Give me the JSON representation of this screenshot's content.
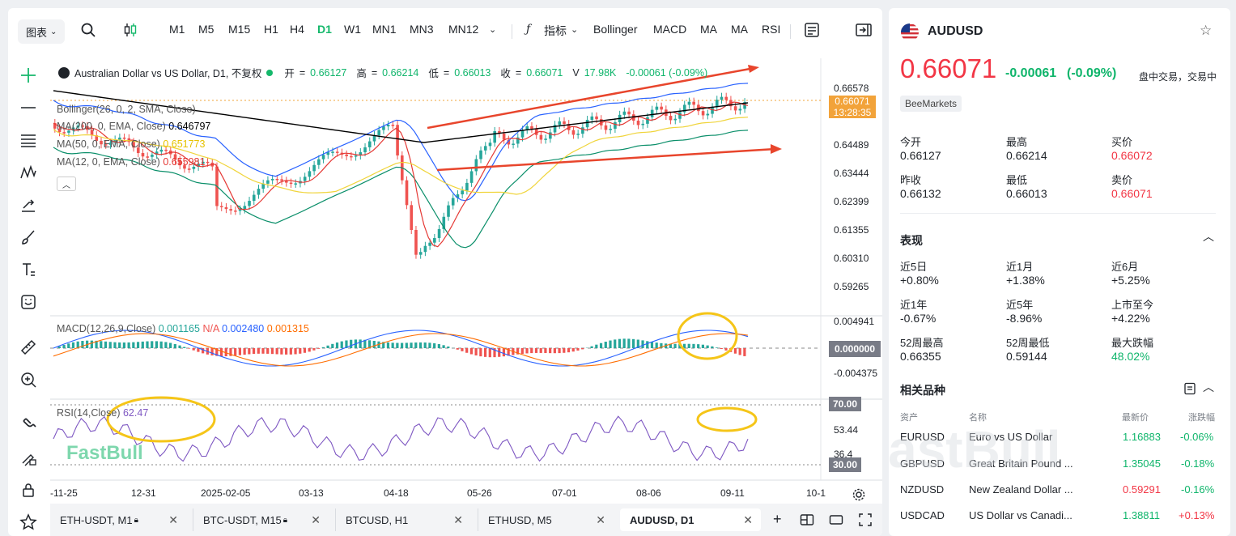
{
  "toolbar": {
    "chart_menu": "图表",
    "timeframes": [
      "M1",
      "M5",
      "M15",
      "H1",
      "H4",
      "D1",
      "W1",
      "MN1",
      "MN3",
      "MN12"
    ],
    "active_timeframe": "D1",
    "indicators_label": "指标",
    "indicator_buttons": [
      "Bollinger",
      "MACD",
      "MA",
      "MA",
      "RSI"
    ]
  },
  "chart": {
    "symbol_line": "Australian Dollar vs US Dollar, D1, 不复权",
    "ohlc": {
      "open_label": "开",
      "open": "0.66127",
      "high_label": "高",
      "high": "0.66214",
      "low_label": "低",
      "low": "0.66013",
      "close_label": "收",
      "close": "0.66071",
      "volume_label": "V",
      "volume": "17.98K",
      "change": "-0.00061 (-0.09%)"
    },
    "legends": {
      "bollinger": "Bollinger(26, 0, 2, SMA, Close)",
      "ma200": "MA(200, 0, EMA, Close)",
      "ma200_val": "0.646797",
      "ma50": "MA(50, 0, EMA, Close)",
      "ma50_val": "0.651773",
      "ma12": "MA(12, 0, EMA, Close)",
      "ma12_val": "0.655981"
    },
    "price_axis": [
      "0.66578",
      "0.64489",
      "0.63444",
      "0.62399",
      "0.61355",
      "0.60310",
      "0.59265"
    ],
    "current_price": "0.66071",
    "countdown": "13:28:35",
    "macd": {
      "label": "MACD(12,26,9,Close)",
      "hist": "0.001165",
      "na": "N/A",
      "macd": "0.002480",
      "signal": "0.001315",
      "axis": [
        "0.004941",
        "0.000000",
        "-0.004375"
      ]
    },
    "rsi": {
      "label": "RSI(14,Close)",
      "value": "62.47",
      "axis": [
        "70.00",
        "53.44",
        "36.4",
        "30.00"
      ]
    },
    "x_axis": [
      "-11-25",
      "12-31",
      "2025-02-05",
      "03-13",
      "04-18",
      "05-26",
      "07-01",
      "08-06",
      "09-11",
      "10-1"
    ],
    "watermark": "FastBull",
    "colors": {
      "up": "#26a69a",
      "down": "#ef5350",
      "accent": "#15b86b",
      "annotation": "#e8452c",
      "highlight": "#f5c518"
    }
  },
  "tabs": [
    {
      "label": "ETH-USDT, M1",
      "locked": true
    },
    {
      "label": "BTC-USDT, M15",
      "locked": true
    },
    {
      "label": "BTCUSD, H1",
      "locked": false
    },
    {
      "label": "ETHUSD, M5",
      "locked": false
    },
    {
      "label": "AUDUSD, D1",
      "locked": false,
      "active": true
    }
  ],
  "panel": {
    "symbol": "AUDUSD",
    "price": "0.66071",
    "change": "-0.00061",
    "change_pct": "(-0.09%)",
    "status": "盘中交易，交易中",
    "source": "BeeMarkets",
    "stats": [
      {
        "label": "今开",
        "value": "0.66127",
        "tone": ""
      },
      {
        "label": "最高",
        "value": "0.66214",
        "tone": ""
      },
      {
        "label": "买价",
        "value": "0.66072",
        "tone": "red"
      },
      {
        "label": "昨收",
        "value": "0.66132",
        "tone": ""
      },
      {
        "label": "最低",
        "value": "0.66013",
        "tone": ""
      },
      {
        "label": "卖价",
        "value": "0.66071",
        "tone": "red"
      }
    ],
    "performance_title": "表现",
    "performance": [
      {
        "label": "近5日",
        "value": "+0.80%"
      },
      {
        "label": "近1月",
        "value": "+1.38%"
      },
      {
        "label": "近6月",
        "value": "+5.25%"
      },
      {
        "label": "近1年",
        "value": "-0.67%"
      },
      {
        "label": "近5年",
        "value": "-8.96%"
      },
      {
        "label": "上市至今",
        "value": "+4.22%"
      },
      {
        "label": "52周最高",
        "value": "0.66355"
      },
      {
        "label": "52周最低",
        "value": "0.59144"
      },
      {
        "label": "最大跌幅",
        "value": "48.02%"
      }
    ],
    "related_title": "相关品种",
    "related_headers": [
      "资产",
      "名称",
      "最新价",
      "涨跌幅"
    ],
    "related": [
      {
        "asset": "EURUSD",
        "name": "Euro vs US Dollar",
        "price": "1.16883",
        "change": "-0.06%",
        "price_tone": "green",
        "change_tone": "green"
      },
      {
        "asset": "GBPUSD",
        "name": "Great Britain Pound ...",
        "price": "1.35045",
        "change": "-0.18%",
        "price_tone": "green",
        "change_tone": "green"
      },
      {
        "asset": "NZDUSD",
        "name": "New Zealand Dollar ...",
        "price": "0.59291",
        "change": "-0.16%",
        "price_tone": "red",
        "change_tone": "green"
      },
      {
        "asset": "USDCAD",
        "name": "US Dollar vs Canadi...",
        "price": "1.38811",
        "change": "+0.13%",
        "price_tone": "green",
        "change_tone": "red"
      }
    ]
  }
}
